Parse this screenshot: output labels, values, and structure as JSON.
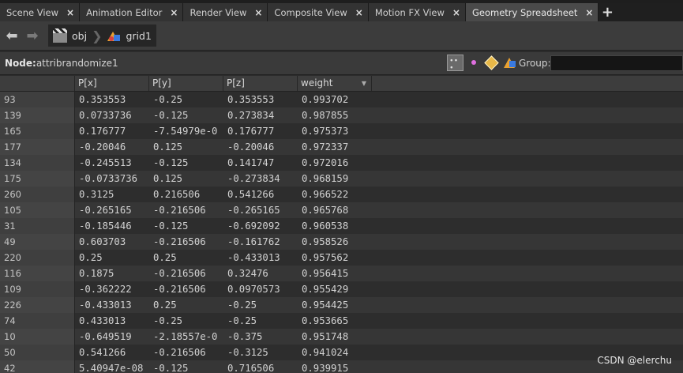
{
  "tabs": [
    {
      "label": "Scene View",
      "active": false
    },
    {
      "label": "Animation Editor",
      "active": false
    },
    {
      "label": "Render View",
      "active": false
    },
    {
      "label": "Composite View",
      "active": false
    },
    {
      "label": "Motion FX View",
      "active": false
    },
    {
      "label": "Geometry Spreadsheet",
      "active": true
    }
  ],
  "nav": {
    "crumb_obj": "obj",
    "crumb_node": "grid1"
  },
  "node_bar": {
    "node_label": "Node:",
    "node_name": "attribrandomize1",
    "group_label": "Group:",
    "group_value": ""
  },
  "table": {
    "columns": [
      "",
      "P[x]",
      "P[y]",
      "P[z]",
      "weight"
    ],
    "sorted_column": "weight",
    "rows": [
      [
        "93",
        "0.353553",
        "-0.25",
        "0.353553",
        "0.993702"
      ],
      [
        "139",
        "0.0733736",
        "-0.125",
        "0.273834",
        "0.987855"
      ],
      [
        "165",
        "0.176777",
        "-7.54979e-0",
        "0.176777",
        "0.975373"
      ],
      [
        "177",
        "-0.20046",
        "0.125",
        "-0.20046",
        "0.972337"
      ],
      [
        "134",
        "-0.245513",
        "-0.125",
        "0.141747",
        "0.972016"
      ],
      [
        "175",
        "-0.0733736",
        "0.125",
        "-0.273834",
        "0.968159"
      ],
      [
        "260",
        "0.3125",
        "0.216506",
        "0.541266",
        "0.966522"
      ],
      [
        "105",
        "-0.265165",
        "-0.216506",
        "-0.265165",
        "0.965768"
      ],
      [
        "31",
        "-0.185446",
        "-0.125",
        "-0.692092",
        "0.960538"
      ],
      [
        "49",
        "0.603703",
        "-0.216506",
        "-0.161762",
        "0.958526"
      ],
      [
        "220",
        "0.25",
        "0.25",
        "-0.433013",
        "0.957562"
      ],
      [
        "116",
        "0.1875",
        "-0.216506",
        "0.32476",
        "0.956415"
      ],
      [
        "109",
        "-0.362222",
        "-0.216506",
        "0.0970573",
        "0.955429"
      ],
      [
        "226",
        "-0.433013",
        "0.25",
        "-0.25",
        "0.954425"
      ],
      [
        "74",
        "0.433013",
        "-0.25",
        "-0.25",
        "0.953665"
      ],
      [
        "10",
        "-0.649519",
        "-2.18557e-0",
        "-0.375",
        "0.951748"
      ],
      [
        "50",
        "0.541266",
        "-0.216506",
        "-0.3125",
        "0.941024"
      ],
      [
        "42",
        "5.40947e-08",
        "-0.125",
        "0.716506",
        "0.939915"
      ]
    ]
  },
  "watermark": "CSDN @elerchu"
}
